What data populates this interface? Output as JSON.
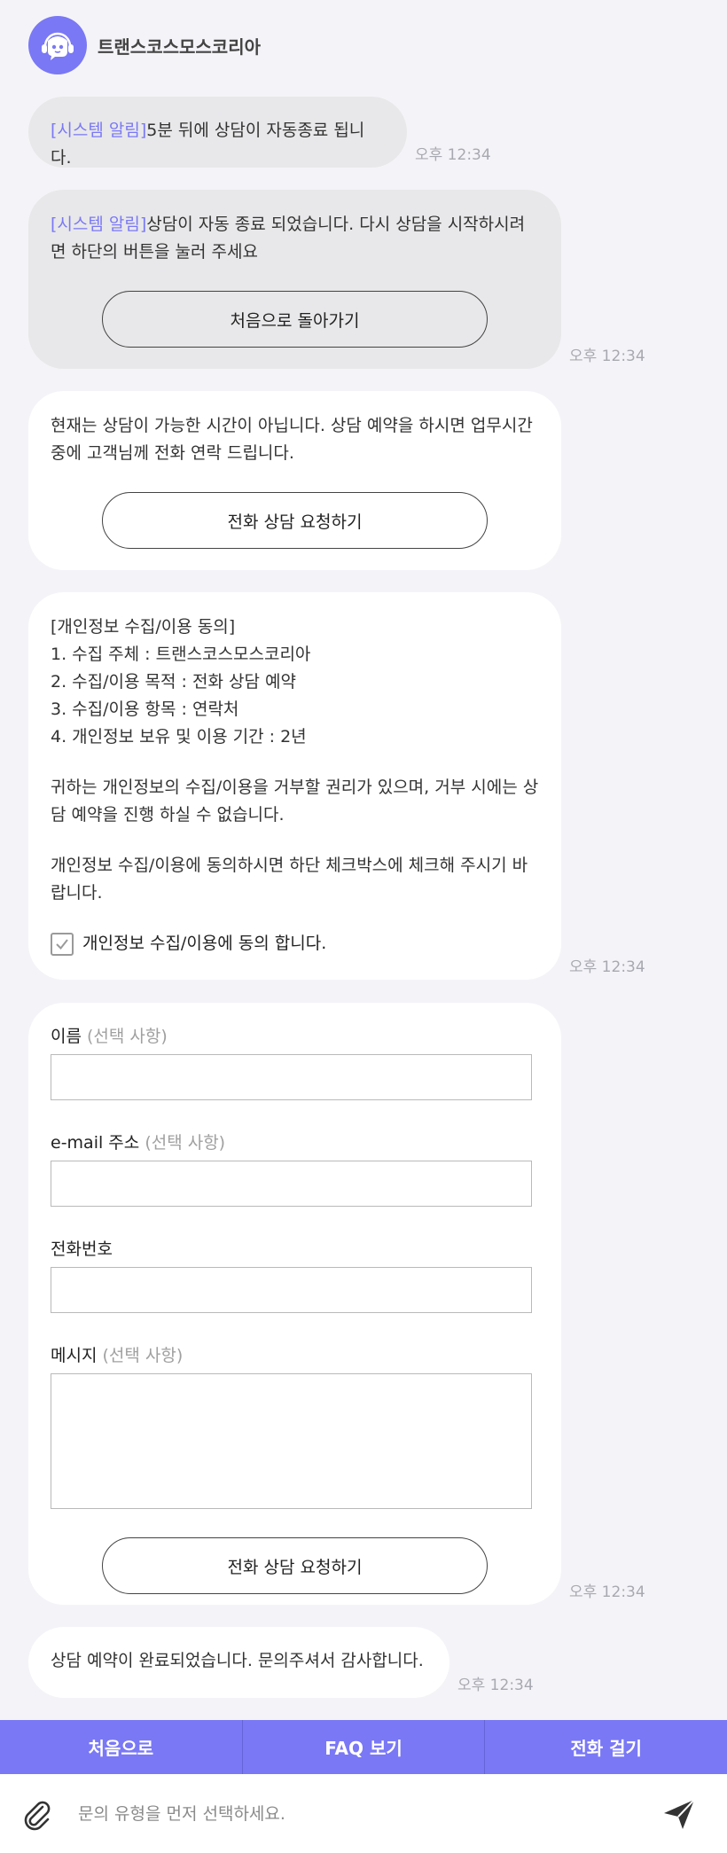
{
  "header": {
    "bot_name": "트랜스코스모스코리아",
    "avatar_icon": "chatbot-headset-icon"
  },
  "messages": {
    "m1": {
      "system_tag": "[시스템 알림]",
      "text": "5분 뒤에 상담이 자동종료 됩니다.",
      "time": "오후 12:34"
    },
    "m2": {
      "system_tag": "[시스템 알림]",
      "text": "상담이 자동 종료 되었습니다. 다시 상담을 시작하시려면 하단의 버튼을 눌러 주세요",
      "button": "처음으로 돌아가기",
      "time": "오후 12:34"
    },
    "m3": {
      "text": "현재는 상담이 가능한 시간이 아닙니다. 상담 예약을 하시면 업무시간 중에 고객님께 전화 연락 드립니다.",
      "button": "전화 상담 요청하기"
    },
    "m4": {
      "title": "[개인정보 수집/이용 동의]",
      "items": [
        "1. 수집 주체 : 트랜스코스모스코리아",
        "2. 수집/이용 목적 : 전화 상담 예약",
        "3. 수집/이용 항목 : 연락처",
        "4. 개인정보 보유 및 이용 기간 : 2년"
      ],
      "para1": "귀하는 개인정보의 수집/이용을 거부할 권리가 있으며, 거부 시에는 상담 예약을 진행 하실 수 없습니다.",
      "para2": "개인정보 수집/이용에 동의하시면 하단 체크박스에 체크해 주시기 바랍니다.",
      "consent_label": "개인정보 수집/이용에 동의 합니다.",
      "consent_checked": true,
      "time": "오후 12:34"
    },
    "m5": {
      "fields": {
        "name": {
          "label": "이름",
          "optional": "(선택 사항)",
          "value": ""
        },
        "email": {
          "label": "e-mail 주소",
          "optional": "(선택 사항)",
          "value": ""
        },
        "phone": {
          "label": "전화번호",
          "value": ""
        },
        "message": {
          "label": "메시지",
          "optional": "(선택 사항)",
          "value": ""
        }
      },
      "button": "전화 상담 요청하기",
      "time": "오후 12:34"
    },
    "m6": {
      "text": "상담 예약이 완료되었습니다. 문의주셔서 감사합니다.",
      "time": "오후 12:34"
    }
  },
  "bottom_nav": {
    "home": "처음으로",
    "faq": "FAQ 보기",
    "call": "전화 걸기"
  },
  "composer": {
    "placeholder": "문의 유형을 먼저 선택하세요.",
    "attach_icon": "paperclip-icon",
    "send_icon": "send-icon"
  },
  "colors": {
    "accent": "#7a78f5",
    "background": "#f4f4f8",
    "bubble_grey": "#e8e8ea",
    "bubble_white": "#ffffff"
  }
}
